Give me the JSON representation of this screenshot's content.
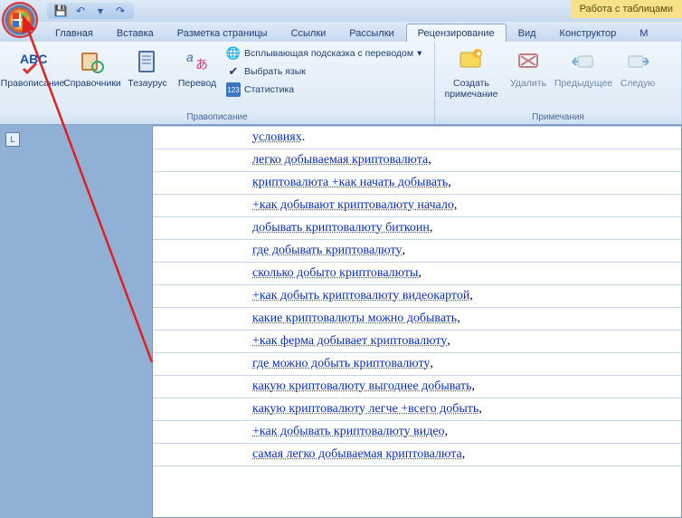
{
  "context_tab": "Работа с таблицами",
  "qat": {
    "save": "💾",
    "undo": "↶",
    "redo": "↷"
  },
  "tabs": [
    {
      "label": "Главная"
    },
    {
      "label": "Вставка"
    },
    {
      "label": "Разметка страницы"
    },
    {
      "label": "Ссылки"
    },
    {
      "label": "Рассылки"
    },
    {
      "label": "Рецензирование"
    },
    {
      "label": "Вид"
    },
    {
      "label": "Конструктор"
    },
    {
      "label": "М"
    }
  ],
  "active_tab_index": 5,
  "ribbon": {
    "group1": {
      "label": "Правописание",
      "spellcheck": "Правописание",
      "references": "Справочники",
      "thesaurus": "Тезаурус",
      "translate": "Перевод",
      "tooltip": "Всплывающая подсказка с переводом",
      "choose_lang": "Выбрать язык",
      "stats": "Статистика"
    },
    "group2": {
      "label": "Примечания",
      "new_comment": "Создать примечание",
      "delete": "Удалить",
      "prev": "Предыдущее",
      "next": "Следую"
    }
  },
  "corner_glyph": "L",
  "rows": [
    {
      "text": "условиях",
      "suffix": "."
    },
    {
      "text": "легко добываемая криптовалюта",
      "suffix": ","
    },
    {
      "text": "криптовалюта +как начать добывать",
      "suffix": ","
    },
    {
      "text": "+как добывают криптовалюту начало",
      "suffix": ","
    },
    {
      "text": "добывать криптовалюту биткоин",
      "suffix": ","
    },
    {
      "text": "где добывать криптовалюту",
      "suffix": ","
    },
    {
      "text": "сколько добыто криптовалюты",
      "suffix": ","
    },
    {
      "text": "+как добыть криптовалюту видеокартой",
      "suffix": ","
    },
    {
      "text": "какие криптовалюты можно добывать",
      "suffix": ","
    },
    {
      "text": "+как ферма добывает криптовалюту",
      "suffix": ","
    },
    {
      "text": "где можно добыть криптовалюту",
      "suffix": ","
    },
    {
      "text": "какую криптовалюту выгоднее добывать",
      "suffix": ","
    },
    {
      "text": "какую криптовалюту легче +всего добыть",
      "suffix": ","
    },
    {
      "text": "+как добывать криптовалюту видео",
      "suffix": ","
    },
    {
      "text": "самая легко добываемая криптовалюта",
      "suffix": ","
    }
  ]
}
